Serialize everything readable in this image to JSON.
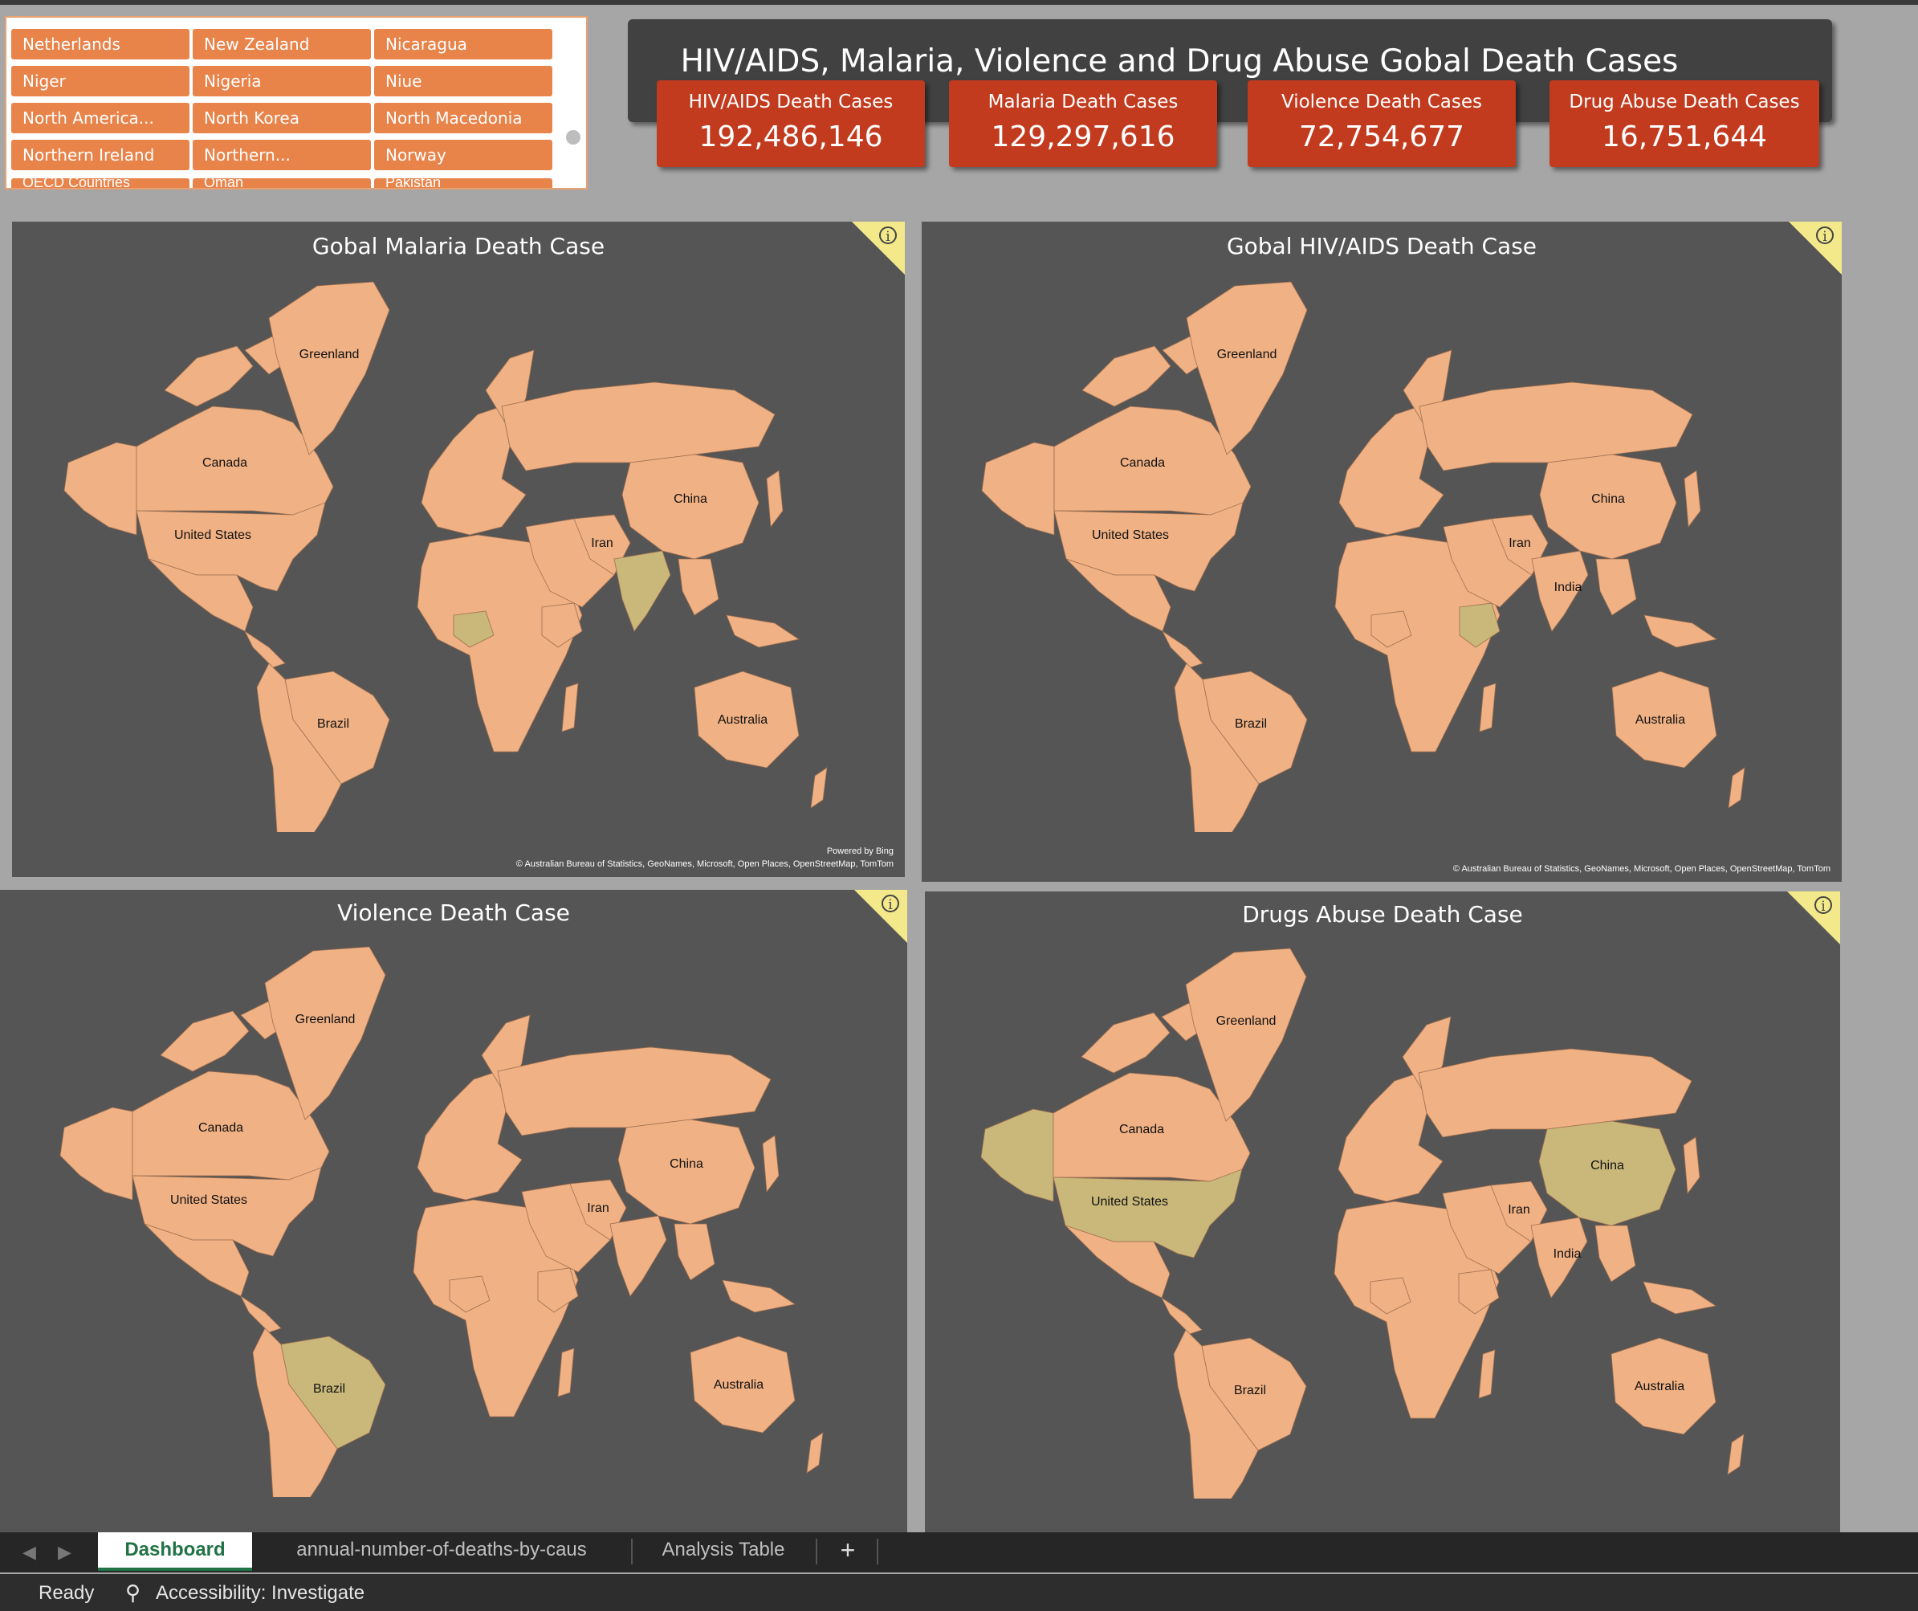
{
  "slicer": {
    "items": [
      "Netherlands",
      "New Zealand",
      "Nicaragua",
      "Niger",
      "Nigeria",
      "Niue",
      "North America...",
      "North Korea",
      "North Macedonia",
      "Northern Ireland",
      "Northern...",
      "Norway"
    ],
    "partial_items": [
      "OECD Countries",
      "Oman",
      "Pakistan"
    ]
  },
  "header": {
    "title": "HIV/AIDS, Malaria, Violence and Drug Abuse Gobal Death Cases"
  },
  "kpis": [
    {
      "label": "HIV/AIDS Death Cases",
      "value": "192,486,146"
    },
    {
      "label": "Malaria Death Cases",
      "value": "129,297,616"
    },
    {
      "label": "Violence Death Cases",
      "value": "72,754,677"
    },
    {
      "label": "Drug Abuse Death Cases",
      "value": "16,751,644"
    }
  ],
  "maps": [
    {
      "title": "Gobal Malaria Death Case",
      "powered": "Powered by Bing",
      "credit": "© Australian Bureau of Statistics, GeoNames, Microsoft, Open Places, OpenStreetMap, TomTom",
      "labels": [
        "Greenland",
        "Canada",
        "United States",
        "Brazil",
        "Iran",
        "China",
        "Australia"
      ],
      "highlight": [
        "Nigeria",
        "India"
      ]
    },
    {
      "title": "Gobal HIV/AIDS Death Case",
      "powered": "",
      "credit": "© Australian Bureau of Statistics, GeoNames, Microsoft, Open Places, OpenStreetMap, TomTom",
      "labels": [
        "Greenland",
        "Canada",
        "United States",
        "Brazil",
        "Iran",
        "India",
        "China",
        "Australia"
      ],
      "highlight": [
        "Ethiopia"
      ]
    },
    {
      "title": "Violence Death Case",
      "powered": "",
      "credit": "",
      "labels": [
        "Greenland",
        "Canada",
        "United States",
        "Brazil",
        "Iran",
        "China",
        "Australia"
      ],
      "highlight": [
        "Brazil"
      ]
    },
    {
      "title": "Drugs Abuse Death Case",
      "powered": "",
      "credit": "",
      "labels": [
        "Greenland",
        "Canada",
        "United States",
        "Brazil",
        "Iran",
        "India",
        "China",
        "Australia"
      ],
      "highlight": [
        "United States",
        "Alaska",
        "China"
      ]
    }
  ],
  "colors": {
    "land": "#f0b184",
    "highlight": "#c9b87a",
    "ocean": "#555555",
    "kpi": "#c23b1e",
    "slicer": "#e8834a"
  },
  "sheet_tabs": [
    "Dashboard",
    "annual-number-of-deaths-by-caus",
    "Analysis Table",
    "+"
  ],
  "status": {
    "ready": "Ready",
    "accessibility": "Accessibility: Investigate"
  }
}
